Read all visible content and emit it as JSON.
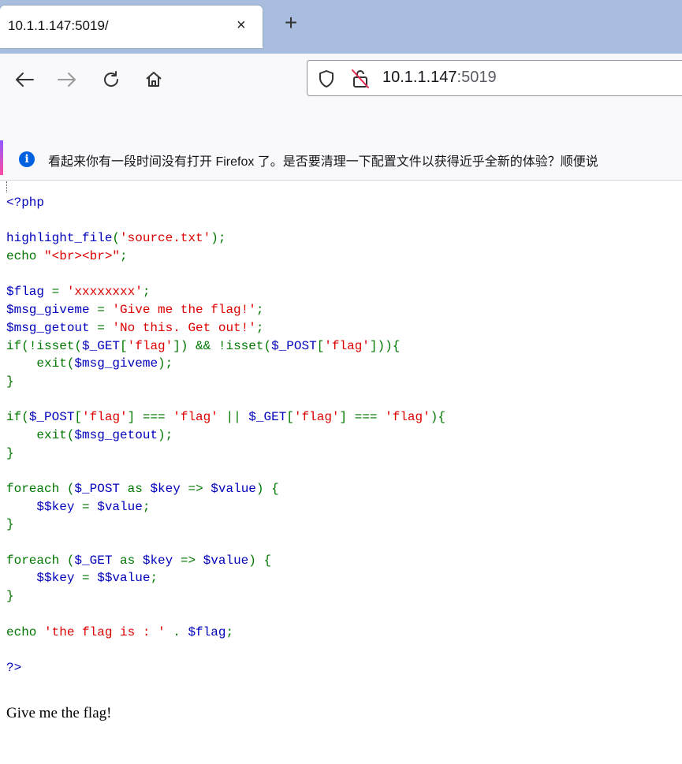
{
  "browser": {
    "tab_title": "10.1.1.147:5019/",
    "tab_close": "×",
    "new_tab": "+",
    "url_host": "10.1.1.147",
    "url_port": ":5019"
  },
  "notification": {
    "text": "看起来你有一段时间没有打开 Firefox 了。是否要清理一下配置文件以获得近乎全新的体验？顺便说"
  },
  "colors": {
    "default": "#0000BB",
    "keyword": "#007700",
    "string": "#DD0000",
    "tabstrip": "#a9bede",
    "info_icon": "#0061e0"
  },
  "code_lines": [
    [
      {
        "t": "<?php",
        "c": "default"
      }
    ],
    [],
    [
      {
        "t": "highlight_file",
        "c": "default"
      },
      {
        "t": "(",
        "c": "keyword"
      },
      {
        "t": "'source.txt'",
        "c": "string"
      },
      {
        "t": ");",
        "c": "keyword"
      }
    ],
    [
      {
        "t": "echo ",
        "c": "keyword"
      },
      {
        "t": "\"<br><br>\"",
        "c": "string"
      },
      {
        "t": ";",
        "c": "keyword"
      }
    ],
    [],
    [
      {
        "t": "$flag ",
        "c": "default"
      },
      {
        "t": "= ",
        "c": "keyword"
      },
      {
        "t": "'xxxxxxxx'",
        "c": "string"
      },
      {
        "t": ";",
        "c": "keyword"
      }
    ],
    [
      {
        "t": "$msg_giveme ",
        "c": "default"
      },
      {
        "t": "= ",
        "c": "keyword"
      },
      {
        "t": "'Give me the flag!'",
        "c": "string"
      },
      {
        "t": ";",
        "c": "keyword"
      }
    ],
    [
      {
        "t": "$msg_getout ",
        "c": "default"
      },
      {
        "t": "= ",
        "c": "keyword"
      },
      {
        "t": "'No this. Get out!'",
        "c": "string"
      },
      {
        "t": ";",
        "c": "keyword"
      }
    ],
    [
      {
        "t": "if(!isset(",
        "c": "keyword"
      },
      {
        "t": "$_GET",
        "c": "default"
      },
      {
        "t": "[",
        "c": "keyword"
      },
      {
        "t": "'flag'",
        "c": "string"
      },
      {
        "t": "]) && !isset(",
        "c": "keyword"
      },
      {
        "t": "$_POST",
        "c": "default"
      },
      {
        "t": "[",
        "c": "keyword"
      },
      {
        "t": "'flag'",
        "c": "string"
      },
      {
        "t": "])){",
        "c": "keyword"
      }
    ],
    [
      {
        "t": "    exit(",
        "c": "keyword"
      },
      {
        "t": "$msg_giveme",
        "c": "default"
      },
      {
        "t": ");",
        "c": "keyword"
      }
    ],
    [
      {
        "t": "}",
        "c": "keyword"
      }
    ],
    [],
    [
      {
        "t": "if(",
        "c": "keyword"
      },
      {
        "t": "$_POST",
        "c": "default"
      },
      {
        "t": "[",
        "c": "keyword"
      },
      {
        "t": "'flag'",
        "c": "string"
      },
      {
        "t": "] === ",
        "c": "keyword"
      },
      {
        "t": "'flag' ",
        "c": "string"
      },
      {
        "t": "|| ",
        "c": "keyword"
      },
      {
        "t": "$_GET",
        "c": "default"
      },
      {
        "t": "[",
        "c": "keyword"
      },
      {
        "t": "'flag'",
        "c": "string"
      },
      {
        "t": "] === ",
        "c": "keyword"
      },
      {
        "t": "'flag'",
        "c": "string"
      },
      {
        "t": "){",
        "c": "keyword"
      }
    ],
    [
      {
        "t": "    exit(",
        "c": "keyword"
      },
      {
        "t": "$msg_getout",
        "c": "default"
      },
      {
        "t": ");",
        "c": "keyword"
      }
    ],
    [
      {
        "t": "}",
        "c": "keyword"
      }
    ],
    [],
    [
      {
        "t": "foreach (",
        "c": "keyword"
      },
      {
        "t": "$_POST ",
        "c": "default"
      },
      {
        "t": "as ",
        "c": "keyword"
      },
      {
        "t": "$key ",
        "c": "default"
      },
      {
        "t": "=> ",
        "c": "keyword"
      },
      {
        "t": "$value",
        "c": "default"
      },
      {
        "t": ") {",
        "c": "keyword"
      }
    ],
    [
      {
        "t": "    ",
        "c": "default"
      },
      {
        "t": "$$key ",
        "c": "default"
      },
      {
        "t": "= ",
        "c": "keyword"
      },
      {
        "t": "$value",
        "c": "default"
      },
      {
        "t": ";",
        "c": "keyword"
      }
    ],
    [
      {
        "t": "}",
        "c": "keyword"
      }
    ],
    [],
    [
      {
        "t": "foreach (",
        "c": "keyword"
      },
      {
        "t": "$_GET ",
        "c": "default"
      },
      {
        "t": "as ",
        "c": "keyword"
      },
      {
        "t": "$key ",
        "c": "default"
      },
      {
        "t": "=> ",
        "c": "keyword"
      },
      {
        "t": "$value",
        "c": "default"
      },
      {
        "t": ") {",
        "c": "keyword"
      }
    ],
    [
      {
        "t": "    ",
        "c": "default"
      },
      {
        "t": "$$key ",
        "c": "default"
      },
      {
        "t": "= ",
        "c": "keyword"
      },
      {
        "t": "$$value",
        "c": "default"
      },
      {
        "t": ";",
        "c": "keyword"
      }
    ],
    [
      {
        "t": "}",
        "c": "keyword"
      }
    ],
    [],
    [
      {
        "t": "echo ",
        "c": "keyword"
      },
      {
        "t": "'the flag is : ' ",
        "c": "string"
      },
      {
        "t": ". ",
        "c": "keyword"
      },
      {
        "t": "$flag",
        "c": "default"
      },
      {
        "t": ";",
        "c": "keyword"
      }
    ],
    [],
    [
      {
        "t": "?>",
        "c": "default"
      }
    ]
  ],
  "page_output": "Give me the flag!"
}
